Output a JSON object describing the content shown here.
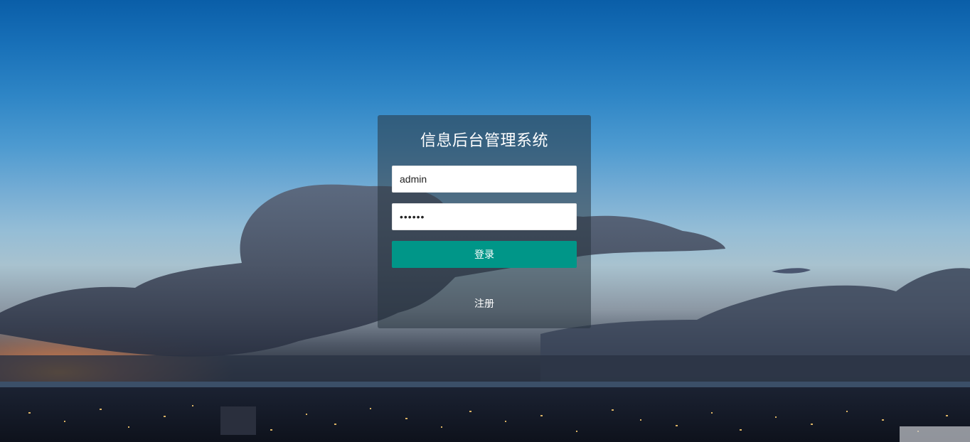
{
  "login": {
    "title": "信息后台管理系统",
    "username_value": "admin",
    "password_value": "123456",
    "login_label": "登录",
    "register_label": "注册"
  },
  "colors": {
    "primary_button": "#009688",
    "card_overlay": "rgba(40,52,64,0.55)"
  }
}
